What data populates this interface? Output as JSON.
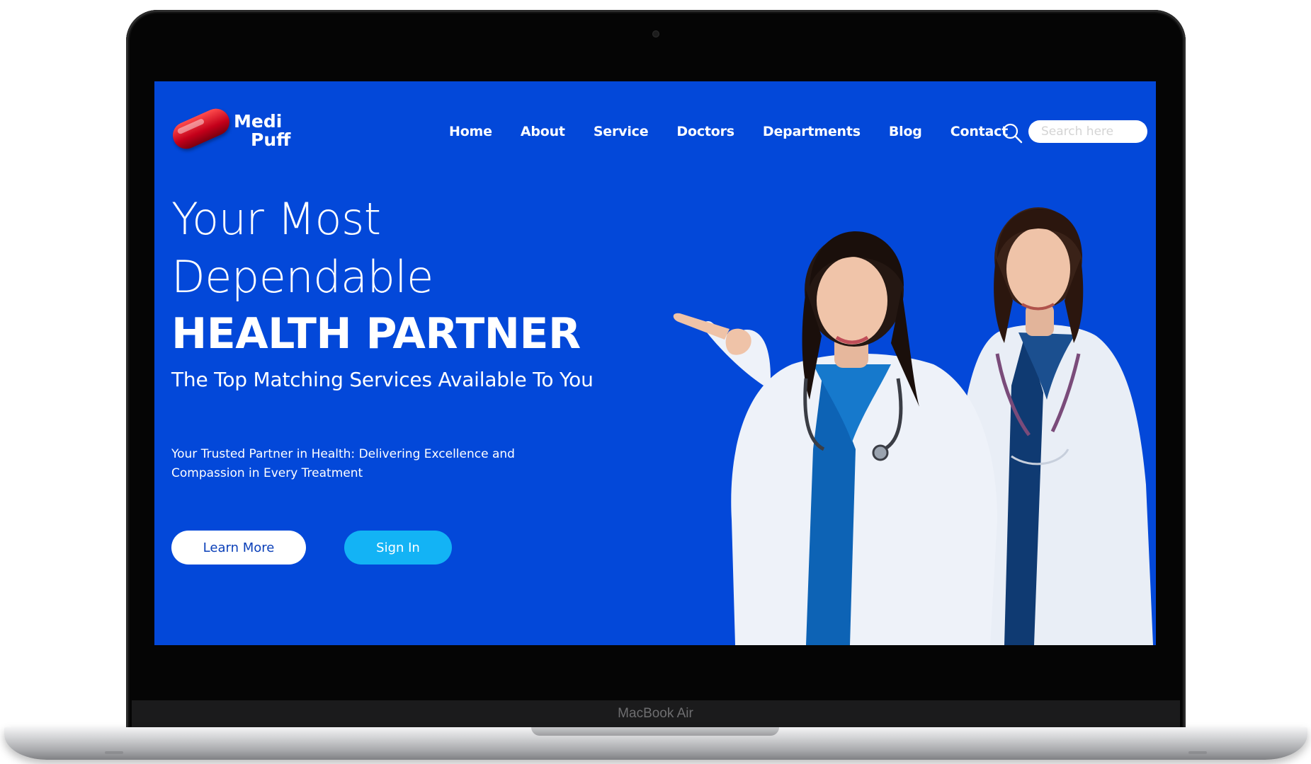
{
  "device": {
    "model_label": "MacBook Air"
  },
  "site": {
    "logo": {
      "line1": "Medi",
      "line2": "Puff"
    },
    "nav": [
      "Home",
      "About",
      "Service",
      "Doctors",
      "Departments",
      "Blog",
      "Contact"
    ],
    "search": {
      "placeholder": "Search here",
      "icon": "search-icon"
    }
  },
  "hero": {
    "heading_line1": "Your Most",
    "heading_line2": "Dependable",
    "heading_line3": "HEALTH PARTNER",
    "subtitle": "The Top Matching Services Available To You",
    "description": "Your Trusted Partner in Health: Delivering Excellence and Compassion in Every Treatment",
    "learn_more_label": "Learn More",
    "sign_in_label": "Sign In"
  },
  "colors": {
    "background": "#0348d9",
    "accent_button": "#13b3f5",
    "logo_pill": "#d0021b",
    "text": "#ffffff"
  }
}
